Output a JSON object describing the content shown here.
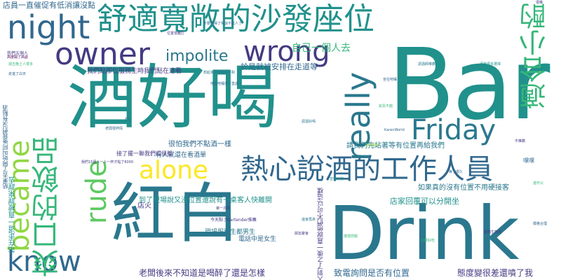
{
  "colors": {
    "bg": "#ffffff",
    "teal": "#21918c",
    "blue": "#31688e",
    "indigo": "#443a83",
    "purple": "#440154",
    "green": "#35b779",
    "lime": "#90d743",
    "yellow": "#fde725",
    "tealdark": "#2a788e",
    "greenlight": "#5ec962"
  },
  "words": {
    "bar": "Bar",
    "drink": "Drink",
    "jiu_hao_he": "酒好喝",
    "hong_bai": "紅白",
    "sofa_seat": "舒適寬敞的沙發座位",
    "staff": "熱心說酒的工作人員",
    "night": "night",
    "owner": "owner",
    "wrong": "wrong",
    "impolite": "impolite",
    "really": "really",
    "friday": "Friday",
    "alone": "alone",
    "became": "became",
    "rude": "rude",
    "know": "know",
    "shuangkou": "爽口的飲品",
    "shihe_xiaozhuo": "適合小酌",
    "ziji_yigeren": "自己一個人去",
    "yushi_anpai": "於是就被安排在走道等",
    "store_notice": "店員一直催促有低消讓沒點",
    "taidu": "態度變很差還噴了我",
    "call_position": "致電詢問是否有位置",
    "laoban": "老闆後來不知道是喝醉了還是怎樣",
    "daole_xianchang": "到了現場說又沒位置還說有一桌客人快離開",
    "zhan_zoudao": "站在走道一直被趕來趕去",
    "dianjia_huifu": "店家回覆可以分開坐",
    "ruguo_zhende": "如果真的沒有位置不用硬接客",
    "qingwo": "請我們先站著等有位置再給我們",
    "henpa": "很怕我們不點酒一樣",
    "youren_zhanzai": "有人就還在看酒單",
    "jieleyitang": "接了擺一聯我們得挺擬",
    "xianchang_fuwu": "現場服務生都男生",
    "dianhua_zhong": "電話中是女生",
    "jintian_bartender": "今天點了bartender推薦",
    "renle_2": "人到了之後一直說他們不可以這樣",
    "wo_ren15": "我們15個人一人一杯才點了6000",
    "neg_vertical_left": "結果去了開始叫阿後我們沒有點酒",
    "dianhuo": "店火",
    "heihei": "嘿嘿",
    "karenworld": "KarenWorld",
    "ps": "Ps",
    "xiaonote_1": "我們點那位服務生時我們點在遠看",
    "xiaonote_2": "不要覺得了常說不是人了",
    "xiaonote_3": "想起來好像有點不對",
    "xiaonote_4": "他在吧檯前一直說",
    "xiaonote_5": "週五晚上人很多",
    "xiaonote_6": "我們五個人",
    "xiaonote_7": "坐在吧檯",
    "xiaonote_8": "調酒師推薦",
    "xiaonote_9": "酒單很多選擇",
    "xiaonote_10": "氣氛不錯",
    "xiaonote_11": "服務生態度",
    "xiaonote_12": "價格合理",
    "xiaonote_13": "還會再來",
    "xiaonote_14": "朋友聚會",
    "xiaonote_15": "環境舒服",
    "xiaonote_16": "音樂好聽",
    "xiaonote_17": "不推薦",
    "xiaonote_18": "等了很久",
    "xiaonote_19": "生日慶祝",
    "xiaonote_20": "第一次來",
    "xiaonote_21": "老闆很熱情",
    "xiaonote_22": "位置很難訂",
    "xiaonote_23": "調酒好喝",
    "xiaonote_24": "小菜好吃",
    "xiaonote_25": "高度開了高處",
    "xiaonote_26": "走進了白天",
    "xiaonote_27": "很推",
    "xiaonote_28": "還可以"
  }
}
